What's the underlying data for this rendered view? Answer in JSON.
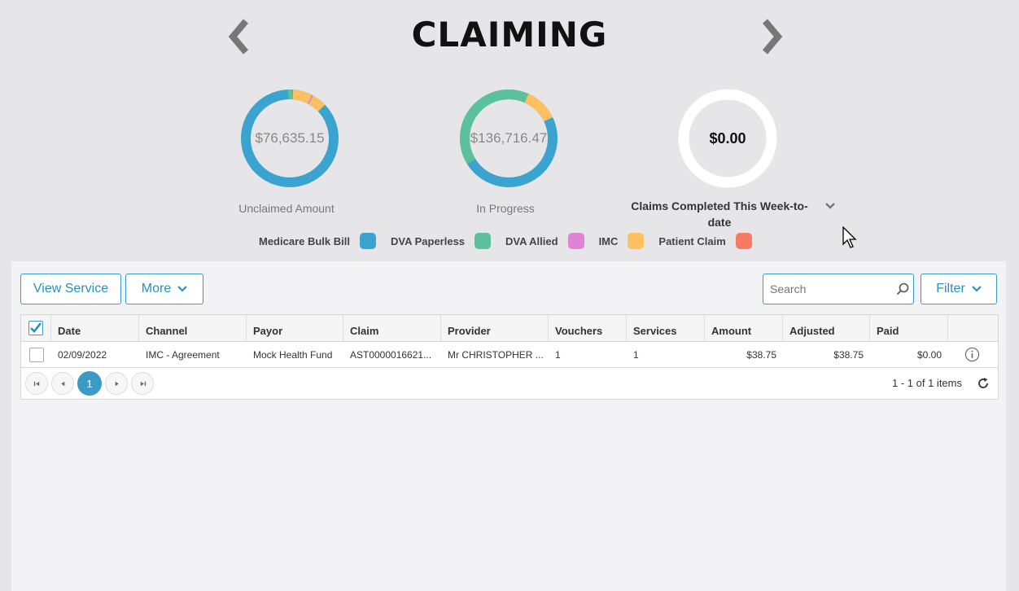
{
  "title": "CLAIMING",
  "summary": {
    "unclaimed": {
      "value": "$76,635.15",
      "label": "Unclaimed Amount"
    },
    "in_progress": {
      "value": "$136,716.47",
      "label": "In Progress"
    },
    "completed": {
      "value": "$0.00",
      "label": "Claims Completed This Week-to-date"
    }
  },
  "legend": [
    {
      "label": "Medicare Bulk Bill",
      "color": "#3aa3d0"
    },
    {
      "label": "DVA Paperless",
      "color": "#5cc09a"
    },
    {
      "label": "DVA Allied",
      "color": "#e083d6"
    },
    {
      "label": "IMC",
      "color": "#ffc062"
    },
    {
      "label": "Patient Claim",
      "color": "#f67b62"
    }
  ],
  "toolbar": {
    "view_service": "View Service",
    "more": "More",
    "search_placeholder": "Search",
    "filter": "Filter"
  },
  "grid": {
    "columns": [
      "Date",
      "Channel",
      "Payor",
      "Claim",
      "Provider",
      "Vouchers",
      "Services",
      "Amount",
      "Adjusted",
      "Paid"
    ],
    "rows": [
      {
        "date": "02/09/2022",
        "channel": "IMC - Agreement",
        "payor": "Mock Health Fund",
        "claim": "AST0000016621...",
        "provider": "Mr CHRISTOPHER ...",
        "vouchers": "1",
        "services": "1",
        "amount": "$38.75",
        "adjusted": "$38.75",
        "paid": "$0.00"
      }
    ],
    "pager": {
      "current_page": "1",
      "info": "1 - 1 of 1 items"
    }
  },
  "icons": [
    "chevron-left-icon",
    "chevron-right-icon",
    "chevron-down-icon",
    "search-icon",
    "info-icon",
    "refresh-icon",
    "checkmark-icon",
    "cursor-icon"
  ]
}
